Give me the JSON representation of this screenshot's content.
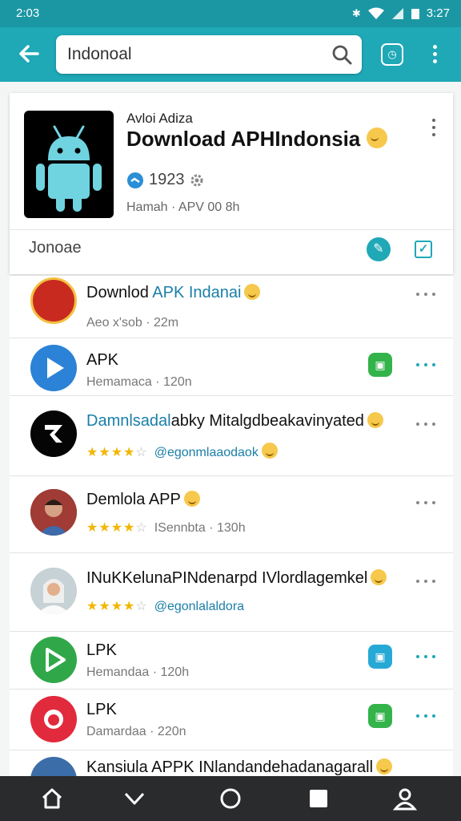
{
  "status_bar": {
    "time_left": "2:03",
    "time_right": "3:27"
  },
  "search": {
    "value": "Indonoal"
  },
  "app_card": {
    "subtitle": "Avloi Adiza",
    "title": "Download APHIndonsia",
    "rating_count": "1923",
    "meta": "Hamah · APV 00 8h",
    "footer_label": "Jonoae"
  },
  "results": [
    {
      "name_prefix": "Downlod ",
      "name_highlight": "APK Indanai",
      "sub": "Aeo x'sob · 22m"
    },
    {
      "name": "APK",
      "sub": "Hemamaca · 120n",
      "badge": "green"
    },
    {
      "name_highlight": "Damnlsadal",
      "name_rest": "abky Mitalgdbeakavinyated",
      "stars": 4.5,
      "handle": "@egonmlaaodaok"
    },
    {
      "name": "Demlola APP",
      "stars": 4.5,
      "handle": "ISennbta · 130h"
    },
    {
      "name": "INuKKelunaPINdenarpd IVlordlagemkel",
      "stars": 4.5,
      "handle": "@egonlalaldora"
    },
    {
      "name": "LPK",
      "sub": "Hemandaa · 120h",
      "badge": "blue"
    },
    {
      "name": "LPK",
      "sub": "Damardaa · 220n",
      "badge": "green"
    },
    {
      "name": "Kansiula APPK INlandandehadanagarall"
    }
  ],
  "colors": {
    "primary": "#1fa8b6",
    "status_bar": "#1b97a4",
    "green_badge": "#34b34a",
    "blue_badge": "#27a9d6",
    "star": "#f2b600",
    "nav_bar": "#2a2b2d"
  },
  "icons": {
    "back": "arrow-left-icon",
    "search": "search-icon",
    "tabs": "tabs-icon",
    "menu": "more-vertical-icon",
    "nav": [
      "home-icon",
      "chevron-down-icon",
      "circle-icon",
      "square-icon",
      "person-icon"
    ]
  }
}
